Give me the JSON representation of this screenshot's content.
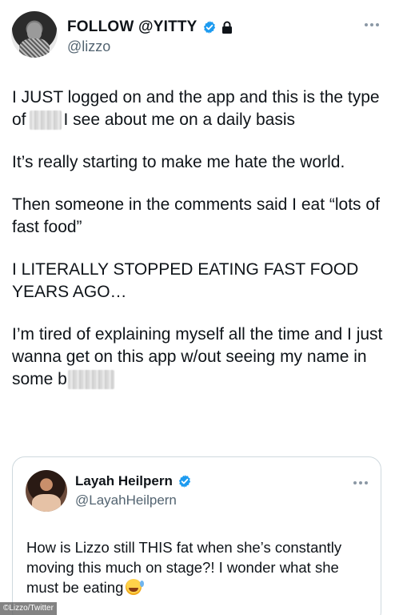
{
  "main_tweet": {
    "display_name": "FOLLOW @YITTY",
    "handle": "@lizzo",
    "verified": true,
    "protected": true,
    "paragraphs": [
      {
        "before": "I JUST logged on and the app and this is the type of",
        "after": "I see about me on a daily basis"
      },
      {
        "text": "It’s really starting to make me hate the world."
      },
      {
        "text": "Then someone in the comments said I eat “lots of fast food”"
      },
      {
        "text": "I LITERALLY STOPPED EATING FAST FOOD YEARS AGO…"
      },
      {
        "before": "I’m tired of explaining myself all the time and I just wanna get on this app w/out seeing my name in some b",
        "after": ""
      }
    ]
  },
  "quoted_tweet": {
    "display_name": "Layah Heilpern",
    "handle": "@LayahHeilpern",
    "verified": true,
    "text": "How is Lizzo still THIS fat when she’s constantly moving this much on stage?! I wonder what she must be eating",
    "emoji": "rolling-on-floor-laughing-emoji"
  },
  "credit": "©Lizzo/Twitter",
  "colors": {
    "verified_blue": "#1d9bf0",
    "text": "#0f1419",
    "secondary_text": "#536471",
    "border": "#cfd9de"
  }
}
